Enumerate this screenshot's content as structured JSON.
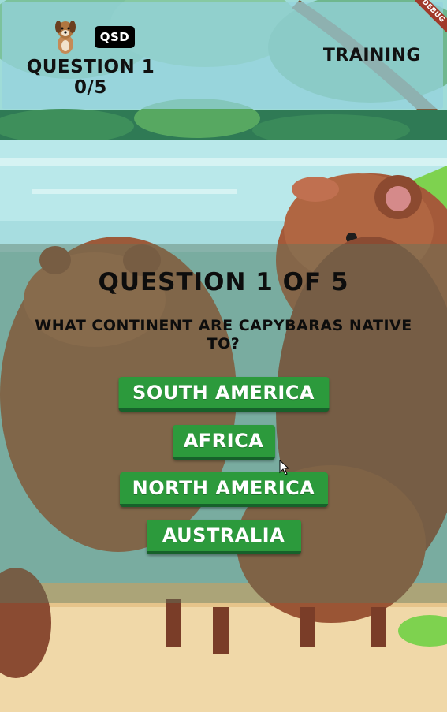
{
  "header": {
    "badge": "QSD",
    "question_label": "QUESTION 1",
    "progress": "0/5",
    "mode": "TRAINING"
  },
  "debug_banner": "DEBUG",
  "quiz": {
    "title": "QUESTION 1 OF 5",
    "question": "WHAT CONTINENT ARE CAPYBARAS NATIVE TO?",
    "answers": [
      "SOUTH AMERICA",
      "AFRICA",
      "NORTH AMERICA",
      "AUSTRALIA"
    ]
  },
  "icons": {
    "avatar": "dog-avatar-icon",
    "cursor": "mouse-cursor-icon"
  },
  "colors": {
    "answer_button": "#2c9a3c",
    "answer_button_shadow": "#16612a",
    "badge": "#000000",
    "debug_banner": "#a03a2a"
  }
}
